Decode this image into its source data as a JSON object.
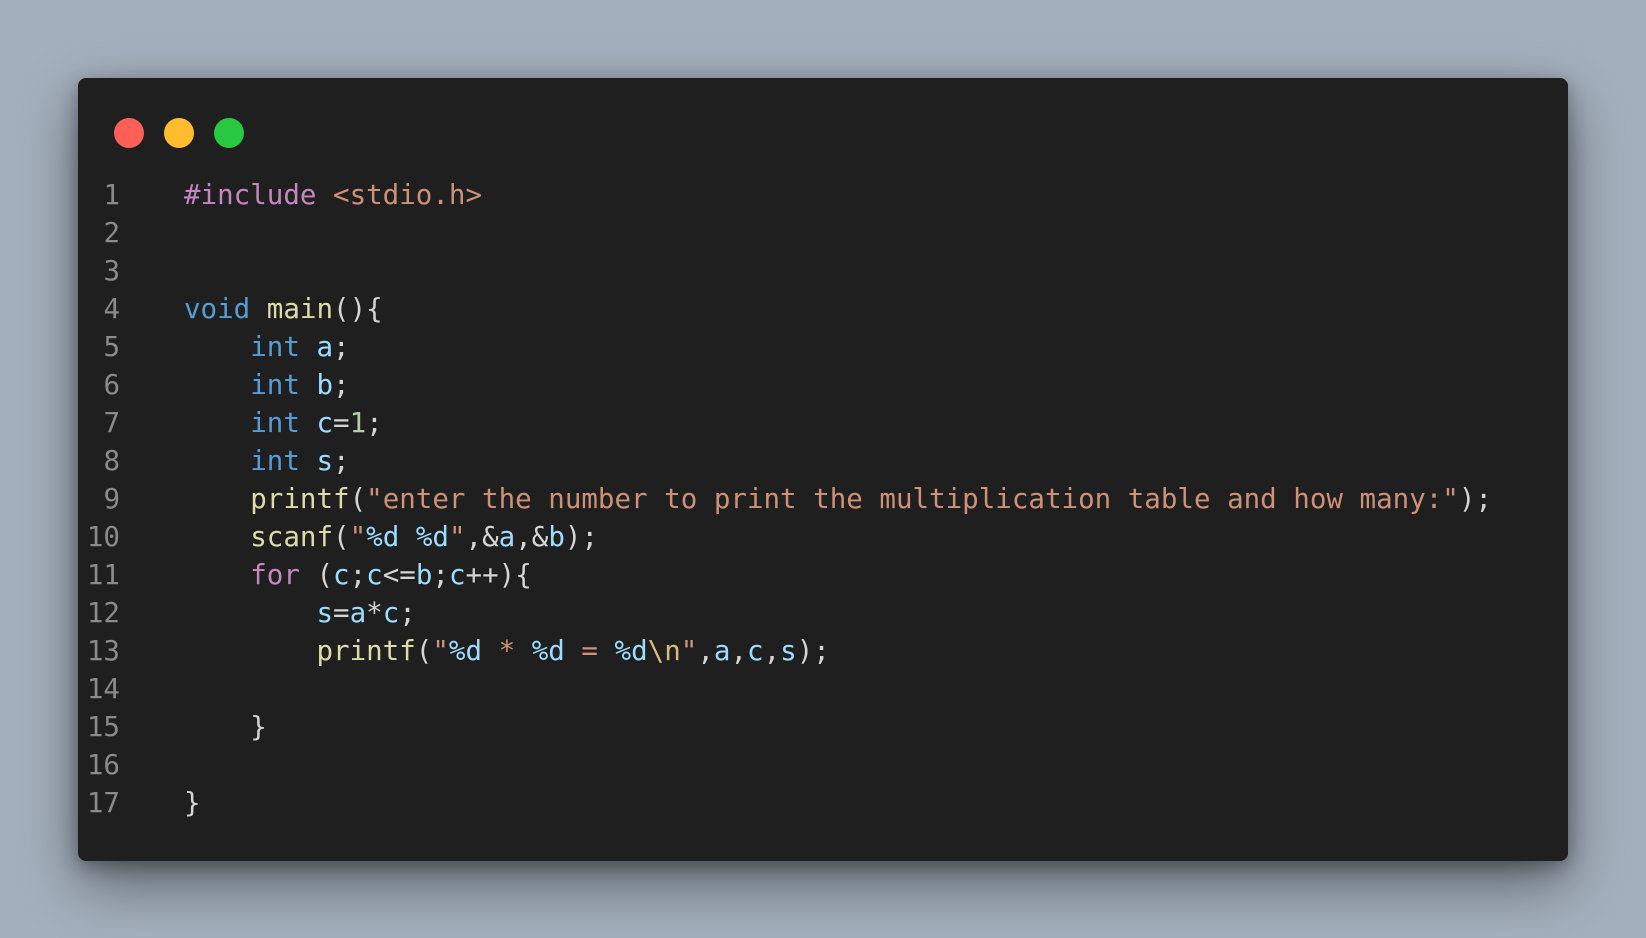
{
  "window": {
    "buttons": [
      {
        "name": "close",
        "color": "#ff5f57"
      },
      {
        "name": "minimize",
        "color": "#febc2e"
      },
      {
        "name": "maximize",
        "color": "#28c840"
      }
    ]
  },
  "colors": {
    "background": "#a4b0bd",
    "editor_bg": "#1f1f1f",
    "line_number": "#8a8a8a",
    "default": "#d4d4d4",
    "preprocessor": "#c586c0",
    "include_path": "#ce9178",
    "keyword_type": "#569cd6",
    "keyword_control": "#c586c0",
    "function": "#dcdcaa",
    "variable": "#9cdcfe",
    "string": "#ce9178",
    "number": "#b5cea8",
    "escape": "#d7ba7d"
  },
  "code": {
    "lines": [
      {
        "number": "1",
        "tokens": [
          {
            "text": "#include",
            "type": "preprocessor"
          },
          {
            "text": " ",
            "type": "default"
          },
          {
            "text": "<stdio.h>",
            "type": "include_path"
          }
        ]
      },
      {
        "number": "2",
        "tokens": []
      },
      {
        "number": "3",
        "tokens": []
      },
      {
        "number": "4",
        "tokens": [
          {
            "text": "void",
            "type": "keyword_type"
          },
          {
            "text": " ",
            "type": "default"
          },
          {
            "text": "main",
            "type": "function"
          },
          {
            "text": "(){",
            "type": "default"
          }
        ]
      },
      {
        "number": "5",
        "tokens": [
          {
            "text": "    ",
            "type": "default"
          },
          {
            "text": "int",
            "type": "keyword_type"
          },
          {
            "text": " ",
            "type": "default"
          },
          {
            "text": "a",
            "type": "variable"
          },
          {
            "text": ";",
            "type": "default"
          }
        ]
      },
      {
        "number": "6",
        "tokens": [
          {
            "text": "    ",
            "type": "default"
          },
          {
            "text": "int",
            "type": "keyword_type"
          },
          {
            "text": " ",
            "type": "default"
          },
          {
            "text": "b",
            "type": "variable"
          },
          {
            "text": ";",
            "type": "default"
          }
        ]
      },
      {
        "number": "7",
        "tokens": [
          {
            "text": "    ",
            "type": "default"
          },
          {
            "text": "int",
            "type": "keyword_type"
          },
          {
            "text": " ",
            "type": "default"
          },
          {
            "text": "c",
            "type": "variable"
          },
          {
            "text": "=",
            "type": "default"
          },
          {
            "text": "1",
            "type": "number"
          },
          {
            "text": ";",
            "type": "default"
          }
        ]
      },
      {
        "number": "8",
        "tokens": [
          {
            "text": "    ",
            "type": "default"
          },
          {
            "text": "int",
            "type": "keyword_type"
          },
          {
            "text": " ",
            "type": "default"
          },
          {
            "text": "s",
            "type": "variable"
          },
          {
            "text": ";",
            "type": "default"
          }
        ]
      },
      {
        "number": "9",
        "tokens": [
          {
            "text": "    ",
            "type": "default"
          },
          {
            "text": "printf",
            "type": "function"
          },
          {
            "text": "(",
            "type": "default"
          },
          {
            "text": "\"enter the number to print the multiplication table and how many:\"",
            "type": "string"
          },
          {
            "text": ");",
            "type": "default"
          }
        ]
      },
      {
        "number": "10",
        "tokens": [
          {
            "text": "    ",
            "type": "default"
          },
          {
            "text": "scanf",
            "type": "function"
          },
          {
            "text": "(",
            "type": "default"
          },
          {
            "text": "\"",
            "type": "string"
          },
          {
            "text": "%d",
            "type": "variable"
          },
          {
            "text": " ",
            "type": "string"
          },
          {
            "text": "%d",
            "type": "variable"
          },
          {
            "text": "\"",
            "type": "string"
          },
          {
            "text": ",&",
            "type": "default"
          },
          {
            "text": "a",
            "type": "variable"
          },
          {
            "text": ",&",
            "type": "default"
          },
          {
            "text": "b",
            "type": "variable"
          },
          {
            "text": ");",
            "type": "default"
          }
        ]
      },
      {
        "number": "11",
        "tokens": [
          {
            "text": "    ",
            "type": "default"
          },
          {
            "text": "for",
            "type": "keyword_control"
          },
          {
            "text": " (",
            "type": "default"
          },
          {
            "text": "c",
            "type": "variable"
          },
          {
            "text": ";",
            "type": "default"
          },
          {
            "text": "c",
            "type": "variable"
          },
          {
            "text": "<=",
            "type": "default"
          },
          {
            "text": "b",
            "type": "variable"
          },
          {
            "text": ";",
            "type": "default"
          },
          {
            "text": "c",
            "type": "variable"
          },
          {
            "text": "++){",
            "type": "default"
          }
        ]
      },
      {
        "number": "12",
        "tokens": [
          {
            "text": "        ",
            "type": "default"
          },
          {
            "text": "s",
            "type": "variable"
          },
          {
            "text": "=",
            "type": "default"
          },
          {
            "text": "a",
            "type": "variable"
          },
          {
            "text": "*",
            "type": "default"
          },
          {
            "text": "c",
            "type": "variable"
          },
          {
            "text": ";",
            "type": "default"
          }
        ]
      },
      {
        "number": "13",
        "tokens": [
          {
            "text": "        ",
            "type": "default"
          },
          {
            "text": "printf",
            "type": "function"
          },
          {
            "text": "(",
            "type": "default"
          },
          {
            "text": "\"",
            "type": "string"
          },
          {
            "text": "%d",
            "type": "variable"
          },
          {
            "text": " * ",
            "type": "string"
          },
          {
            "text": "%d",
            "type": "variable"
          },
          {
            "text": " = ",
            "type": "string"
          },
          {
            "text": "%d",
            "type": "variable"
          },
          {
            "text": "\\n",
            "type": "escape"
          },
          {
            "text": "\"",
            "type": "string"
          },
          {
            "text": ",",
            "type": "default"
          },
          {
            "text": "a",
            "type": "variable"
          },
          {
            "text": ",",
            "type": "default"
          },
          {
            "text": "c",
            "type": "variable"
          },
          {
            "text": ",",
            "type": "default"
          },
          {
            "text": "s",
            "type": "variable"
          },
          {
            "text": ");",
            "type": "default"
          }
        ]
      },
      {
        "number": "14",
        "tokens": []
      },
      {
        "number": "15",
        "tokens": [
          {
            "text": "    }",
            "type": "default"
          }
        ]
      },
      {
        "number": "16",
        "tokens": []
      },
      {
        "number": "17",
        "tokens": [
          {
            "text": "}",
            "type": "default"
          }
        ]
      }
    ]
  }
}
